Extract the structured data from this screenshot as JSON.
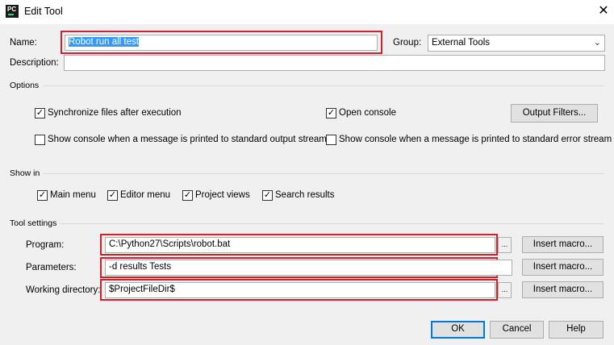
{
  "window": {
    "title": "Edit Tool",
    "app_icon_text": "PC",
    "close_glyph": "✕"
  },
  "form": {
    "name_label": "Name:",
    "name_value": "Robot run all test",
    "group_label": "Group:",
    "group_value": "External Tools",
    "description_label": "Description:",
    "description_value": ""
  },
  "options": {
    "section_label": "Options",
    "sync_files": {
      "label": "Synchronize files after execution",
      "checked": true
    },
    "open_console": {
      "label": "Open console",
      "checked": true
    },
    "output_filters_button": "Output Filters...",
    "console_stdout": {
      "label": "Show console when a message is printed to standard output stream",
      "checked": false
    },
    "console_stderr": {
      "label": "Show console when a message is printed to standard error stream",
      "checked": false
    }
  },
  "show_in": {
    "section_label": "Show in",
    "main_menu": {
      "label": "Main menu",
      "checked": true
    },
    "editor_menu": {
      "label": "Editor menu",
      "checked": true
    },
    "project_views": {
      "label": "Project views",
      "checked": true
    },
    "search_results": {
      "label": "Search results",
      "checked": true
    }
  },
  "tool_settings": {
    "section_label": "Tool settings",
    "program_label": "Program:",
    "program_value": "C:\\Python27\\Scripts\\robot.bat",
    "parameters_label": "Parameters:",
    "parameters_value": "-d results Tests",
    "working_dir_label": "Working directory:",
    "working_dir_value": "$ProjectFileDir$",
    "browse_glyph": "...",
    "insert_macro_label": "Insert macro..."
  },
  "buttons": {
    "ok": "OK",
    "cancel": "Cancel",
    "help": "Help"
  },
  "colors": {
    "highlight_border": "#d0212d",
    "selection": "#3399ff",
    "check_mark": "✓"
  }
}
